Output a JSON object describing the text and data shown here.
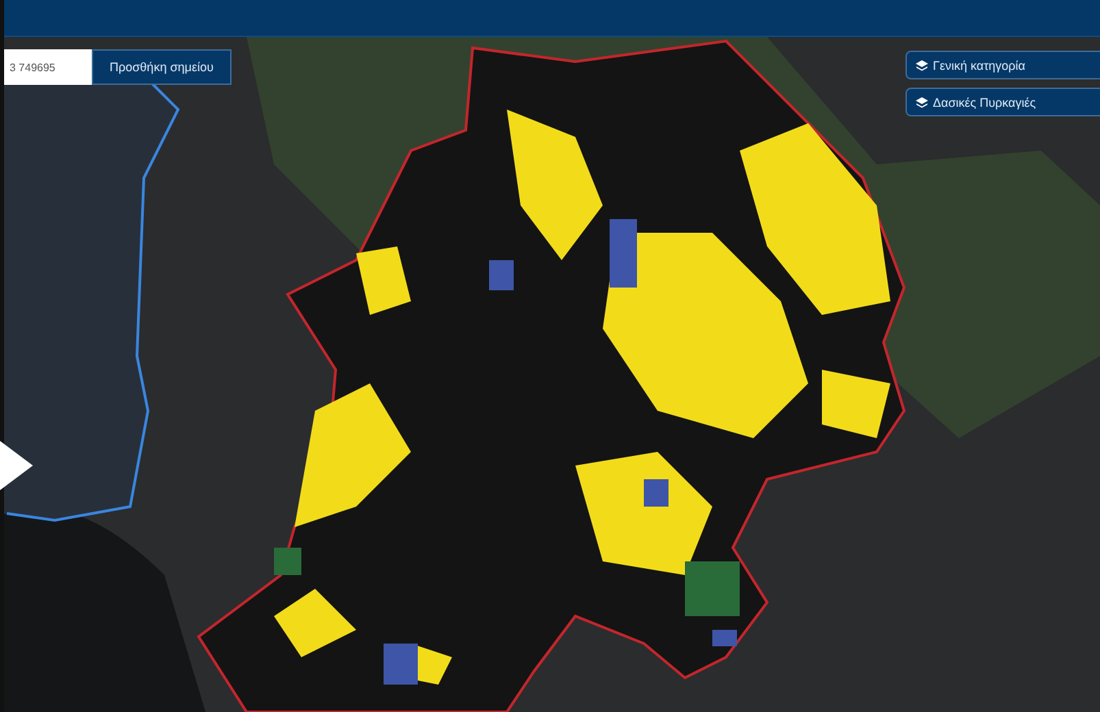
{
  "point_form": {
    "value": "3 749695",
    "button": "Προσθήκη σημείου"
  },
  "layers": [
    {
      "label": "Γενική κατηγορία"
    },
    {
      "label": "Δασικές Πυρκαγιές"
    }
  ]
}
